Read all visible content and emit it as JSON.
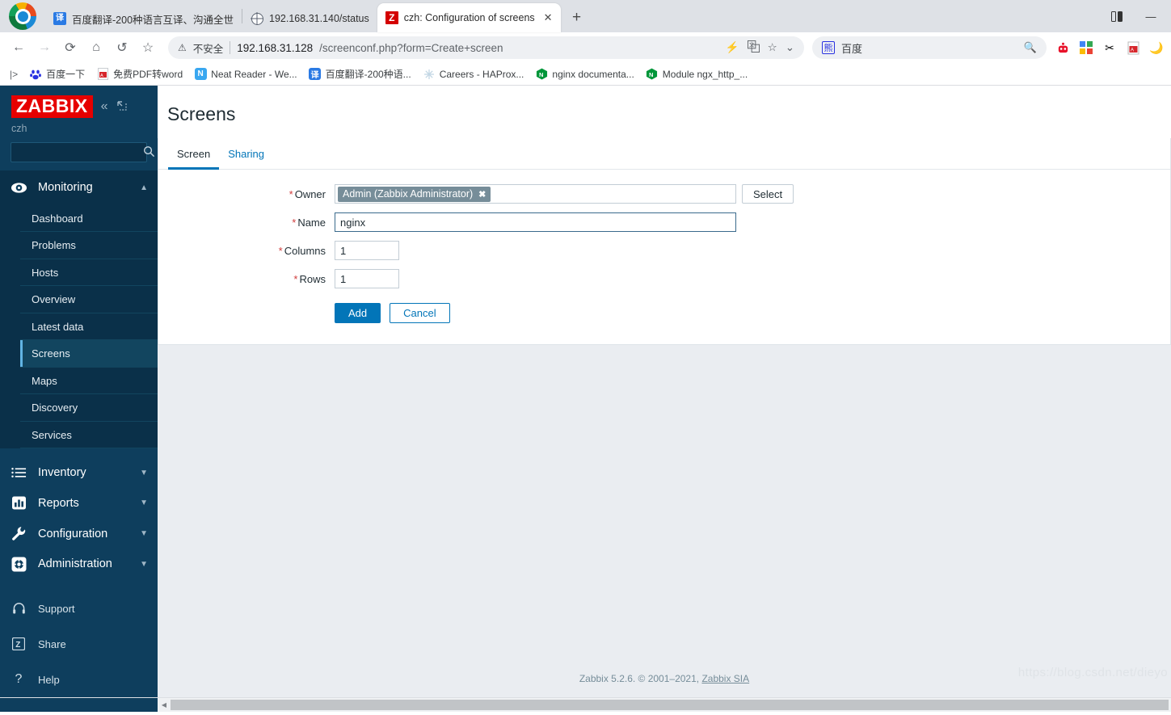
{
  "browser": {
    "tabs": [
      {
        "title": "百度翻译-200种语言互译、沟通全世",
        "favicon": "translate-icon",
        "active": false
      },
      {
        "title": "192.168.31.140/status",
        "favicon": "globe-icon",
        "active": false
      },
      {
        "title": "czh: Configuration of screens",
        "favicon": "zabbix-icon",
        "active": true
      }
    ],
    "new_tab_label": "+",
    "close_label": "✕",
    "window_controls": {
      "split_screen": "⊐",
      "minimize": "—"
    },
    "toolbar": {
      "back": "←",
      "forward": "→",
      "reload": "⟳",
      "home": "⌂",
      "history": "↺",
      "favorite": "☆",
      "security_icon": "warning-icon",
      "security_text": "不安全",
      "url_host": "192.168.31.128",
      "url_path": "/screenconf.php?form=Create+screen",
      "actions": {
        "flash": "⚡",
        "translate": "译",
        "star": "☆",
        "chevron": "⌄"
      }
    },
    "search": {
      "engine_icon": "baidu-icon",
      "value": "百度",
      "mag": "search-icon"
    },
    "extensions": [
      "bot-icon",
      "grid-icon",
      "scissors-icon",
      "pdf-icon",
      "moon-icon"
    ],
    "bookmarks": [
      {
        "label": "百度一下",
        "icon": "baidu-paw-icon",
        "color": "#2932e1"
      },
      {
        "label": "免费PDF转word",
        "icon": "pdf-icon",
        "color": "#d93025"
      },
      {
        "label": "Neat Reader - We...",
        "icon": "neat-reader-icon",
        "color": "#39a7f0"
      },
      {
        "label": "百度翻译-200种语...",
        "icon": "translate-icon",
        "color": "#2a7ae4"
      },
      {
        "label": "Careers - HAProx...",
        "icon": "haproxy-icon",
        "color": "#b8cfdd"
      },
      {
        "label": "nginx documenta...",
        "icon": "nginx-icon",
        "color": "#009639"
      },
      {
        "label": "Module ngx_http_...",
        "icon": "nginx-icon",
        "color": "#009639"
      }
    ]
  },
  "sidebar": {
    "logo": "ZABBIX",
    "user": "czh",
    "collapse_icon": "chevron-double-left-icon",
    "expand_icon": "expand-icon",
    "search_placeholder": "",
    "search_value": "",
    "sections": [
      {
        "label": "Monitoring",
        "icon": "eye-icon",
        "expanded": true,
        "items": [
          {
            "label": "Dashboard",
            "selected": false
          },
          {
            "label": "Problems",
            "selected": false
          },
          {
            "label": "Hosts",
            "selected": false
          },
          {
            "label": "Overview",
            "selected": false
          },
          {
            "label": "Latest data",
            "selected": false
          },
          {
            "label": "Screens",
            "selected": true
          },
          {
            "label": "Maps",
            "selected": false
          },
          {
            "label": "Discovery",
            "selected": false
          },
          {
            "label": "Services",
            "selected": false
          }
        ]
      },
      {
        "label": "Inventory",
        "icon": "list-icon",
        "expanded": false,
        "items": []
      },
      {
        "label": "Reports",
        "icon": "chart-bar-icon",
        "expanded": false,
        "items": []
      },
      {
        "label": "Configuration",
        "icon": "wrench-icon",
        "expanded": false,
        "items": []
      },
      {
        "label": "Administration",
        "icon": "gear-icon",
        "expanded": false,
        "items": []
      }
    ],
    "bottom_links": [
      {
        "label": "Support",
        "icon": "headset-icon"
      },
      {
        "label": "Share",
        "icon": "zabbix-z-icon"
      },
      {
        "label": "Help",
        "icon": "question-icon"
      }
    ]
  },
  "page": {
    "title": "Screens",
    "tabs": [
      {
        "label": "Screen",
        "active": true
      },
      {
        "label": "Sharing",
        "active": false
      }
    ],
    "form": {
      "owner": {
        "label": "Owner",
        "required": true,
        "chip": "Admin (Zabbix Administrator)",
        "chip_remove": "✖",
        "select_button": "Select"
      },
      "name": {
        "label": "Name",
        "required": true,
        "value": "nginx",
        "placeholder": ""
      },
      "columns": {
        "label": "Columns",
        "required": true,
        "value": "1"
      },
      "rows": {
        "label": "Rows",
        "required": true,
        "value": "1"
      },
      "buttons": {
        "add": "Add",
        "cancel": "Cancel"
      }
    },
    "footer": {
      "text": "Zabbix 5.2.6. © 2001–2021, ",
      "link": "Zabbix SIA"
    },
    "watermark": "https://blog.csdn.net/dieyo"
  },
  "colors": {
    "zabbix_red": "#e60000",
    "sidebar_bg": "#0e3e5d",
    "accent_blue": "#0275b8",
    "selected_bar": "#61b4e4",
    "chip_bg": "#768d99",
    "content_bg": "#eaedf1"
  }
}
